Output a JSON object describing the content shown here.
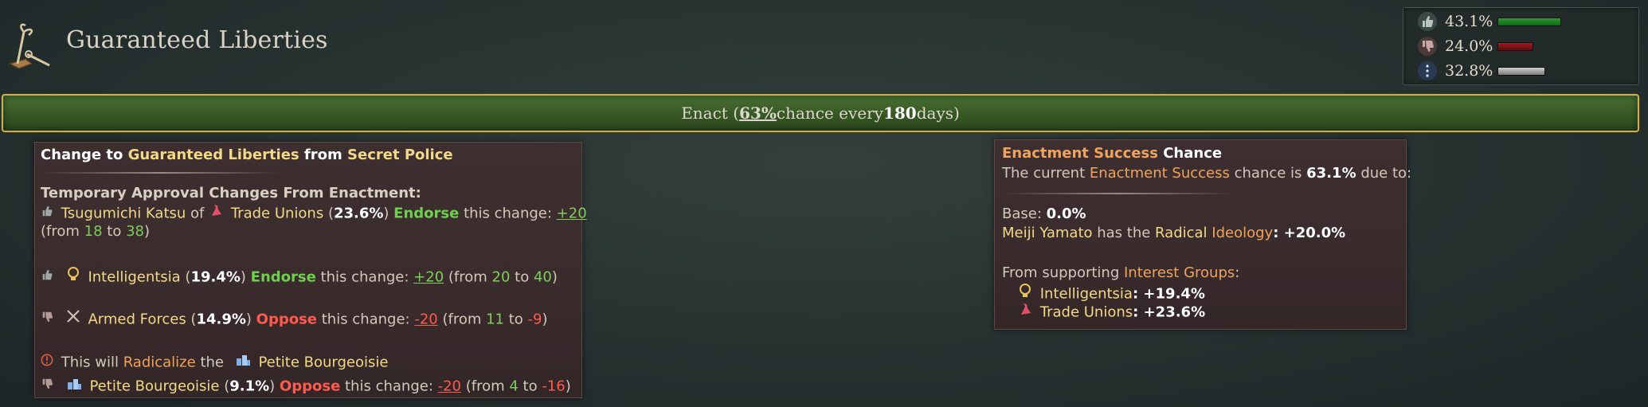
{
  "header": {
    "law_title": "Guaranteed Liberties",
    "law_icon": "law-scroll-icon"
  },
  "support": {
    "rows": [
      {
        "icon": "thumbs-up-icon",
        "pct": "43.1%",
        "color": "#1e7a24",
        "fraction": 0.431
      },
      {
        "icon": "thumbs-down-icon",
        "pct": "24.0%",
        "color": "#8a1a1a",
        "fraction": 0.24
      },
      {
        "icon": "neutral-dots-icon",
        "pct": "32.8%",
        "color": "#a7a7a7",
        "fraction": 0.328
      }
    ]
  },
  "enact": {
    "prefix": "Enact (",
    "chance": "63%",
    "mid": " chance every ",
    "days": "180",
    "suffix": " days)"
  },
  "left_tooltip": {
    "title_pre": "Change to ",
    "title_law": "Guaranteed Liberties",
    "title_mid": " from ",
    "title_from": "Secret Police",
    "section": "Temporary Approval Changes From Enactment:",
    "e1": {
      "name": "Tsugumichi Katsu",
      "of": " of ",
      "group": "Trade Unions",
      "open": " (",
      "pct": "23.6%",
      "close": ") ",
      "stance": "Endorse",
      "mid": " this change: ",
      "delta": "+20",
      "from_pre": "(from ",
      "from": "18",
      "to_word": " to ",
      "to": "38",
      "from_post": ")"
    },
    "e2": {
      "group": "Intelligentsia",
      "open": " (",
      "pct": "19.4%",
      "close": ") ",
      "stance": "Endorse",
      "mid": " this change: ",
      "delta": "+20",
      "from_pre": " (from ",
      "from": "20",
      "to_word": " to ",
      "to": "40",
      "from_post": ")"
    },
    "e3": {
      "group": "Armed Forces",
      "open": " (",
      "pct": "14.9%",
      "close": ") ",
      "stance": "Oppose",
      "mid": " this change: ",
      "delta": "-20",
      "from_pre": " (from ",
      "from": "11",
      "to_word": " to ",
      "to": "-9",
      "from_post": ")"
    },
    "radical": {
      "pre": "This will ",
      "word": "Radicalize",
      "mid": " the ",
      "group": "Petite Bourgeoisie"
    },
    "e4": {
      "group": "Petite Bourgeoisie",
      "open": " (",
      "pct": "9.1%",
      "close": ") ",
      "stance": "Oppose",
      "mid": " this change: ",
      "delta": "-20",
      "from_pre": " (from ",
      "from": "4",
      "to_word": " to ",
      "to": "-16",
      "from_post": ")"
    }
  },
  "right_tooltip": {
    "title_term": "Enactment Success",
    "title_rest": " Chance",
    "line1_pre": "The current ",
    "line1_term": "Enactment Success",
    "line1_mid": " chance is ",
    "line1_val": "63.1%",
    "line1_post": " due to:",
    "base_label": "Base: ",
    "base_val": "0.0%",
    "leader": "Meiji Yamato",
    "leader_mid": " has the ",
    "ideology1": "Radical",
    "ideology2": "Ideology",
    "ideology_val": ": +20.0%",
    "supp_pre": "From supporting ",
    "supp_term": "Interest Groups",
    "supp_post": ":",
    "ig1": "Intelligentsia",
    "ig1_val": ": +19.4%",
    "ig2": "Trade Unions",
    "ig2_val": ": +23.6%"
  },
  "colors": {
    "gold_text": "#f2d98a",
    "orange_text": "#f0a35c",
    "endorse_green": "#6fcf4f",
    "oppose_red": "#ff5a4d",
    "enact_green": "#3a5c27",
    "enact_border": "#c9b15a"
  }
}
